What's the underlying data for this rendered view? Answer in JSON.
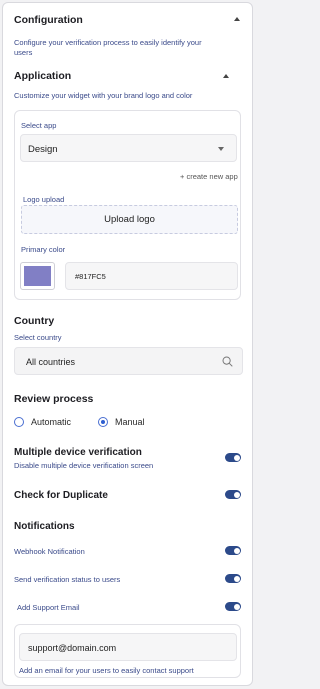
{
  "configuration": {
    "title": "Configuration",
    "description_line1": "Configure your verification process to easily identify your",
    "description_line2": "users"
  },
  "application": {
    "title": "Application",
    "description": "Customize your widget with your brand logo and color",
    "select_app_label": "Select app",
    "select_app_value": "Design",
    "create_new_app_link": "+ create new app",
    "logo_upload_label": "Logo upload",
    "upload_logo_button": "Upload logo",
    "primary_color_label": "Primary color",
    "primary_color_value": "#817FC5",
    "primary_color_swatch": "#817FC5"
  },
  "country": {
    "title": "Country",
    "select_label": "Select country",
    "value": "All countries"
  },
  "review_process": {
    "title": "Review process",
    "options": [
      {
        "label": "Automatic",
        "selected": false
      },
      {
        "label": "Manual",
        "selected": true
      }
    ]
  },
  "multiple_device": {
    "title": "Multiple device verification",
    "description": "Disable multiple device verification screen",
    "enabled": true
  },
  "duplicate": {
    "title": "Check for Duplicate",
    "enabled": true
  },
  "notifications": {
    "title": "Notifications",
    "items": [
      {
        "label": "Webhook Notification",
        "enabled": true
      },
      {
        "label": "Send verification status to users",
        "enabled": true
      },
      {
        "label": "Add Support Email",
        "enabled": true
      }
    ],
    "support_email_value": "support@domain.com",
    "support_email_help": "Add an email for your users to easily contact support"
  },
  "colors": {
    "accent": "#2c4a8a",
    "radio": "#2f5fd0",
    "link": "#3a4a8a"
  }
}
